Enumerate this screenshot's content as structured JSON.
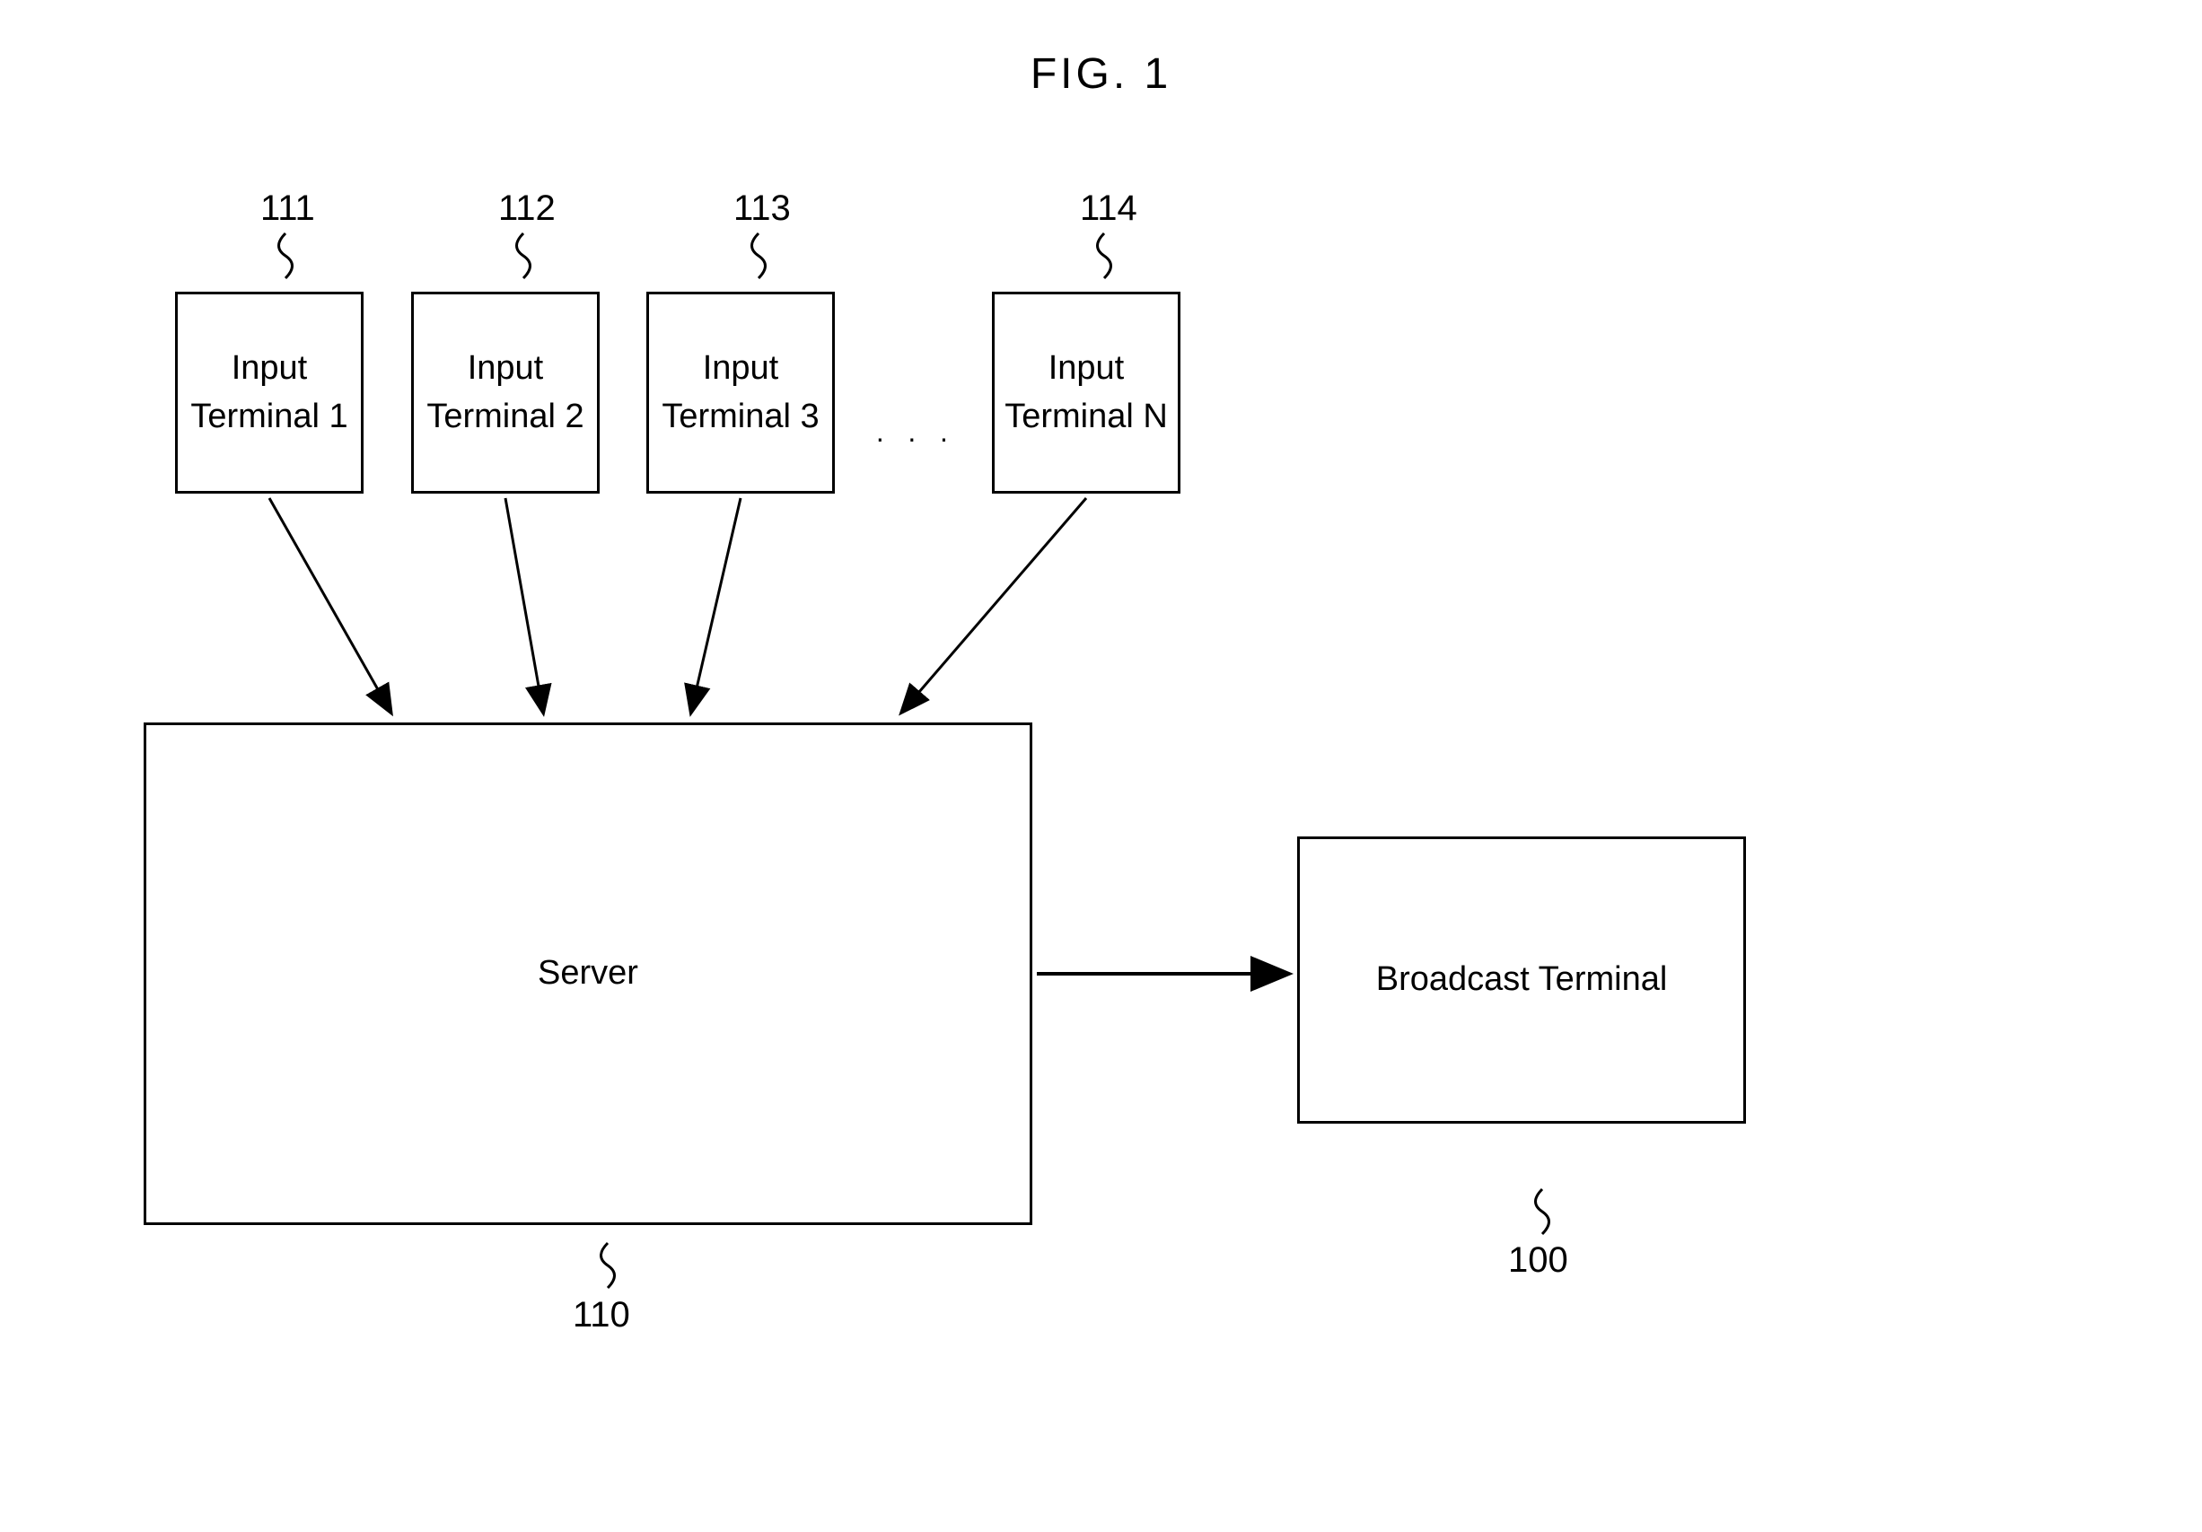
{
  "title": "FIG. 1",
  "references": {
    "ref111": "111",
    "ref112": "112",
    "ref113": "113",
    "ref114": "114",
    "ref110": "110",
    "ref100": "100"
  },
  "boxes": {
    "input1": "Input\nTerminal 1",
    "input2": "Input\nTerminal 2",
    "input3": "Input\nTerminal 3",
    "inputN": "Input\nTerminal N",
    "server": "Server",
    "broadcast": "Broadcast Terminal"
  },
  "ellipsis": "· · ·"
}
